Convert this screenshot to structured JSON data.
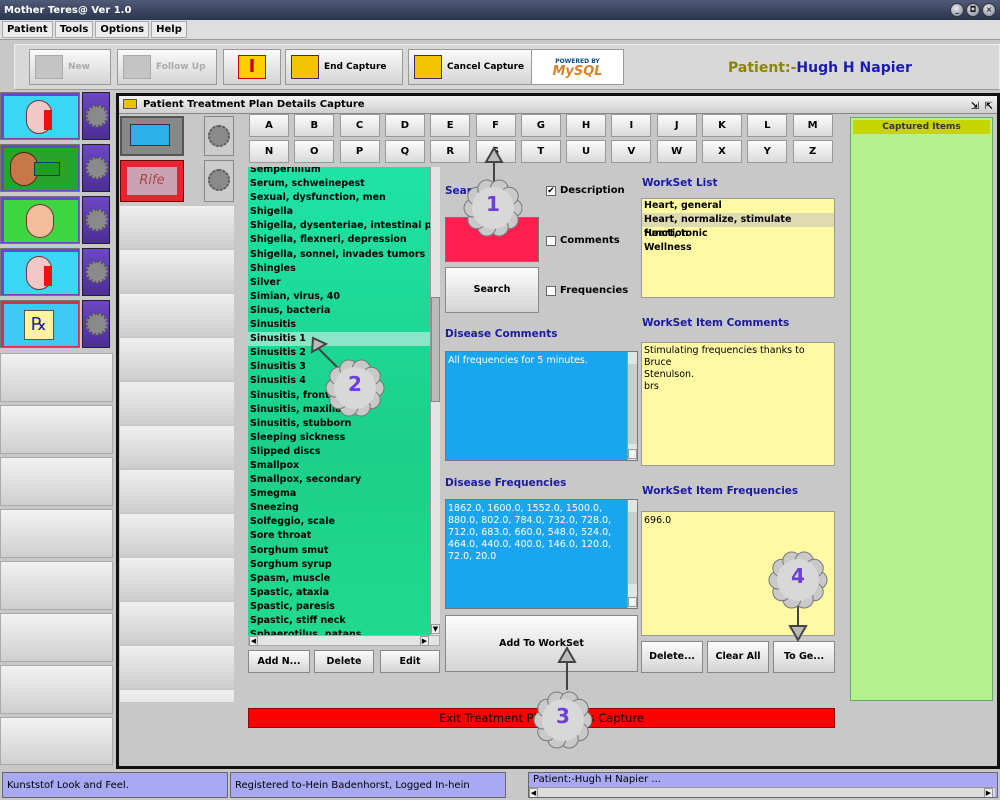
{
  "window": {
    "title": "Mother Teres@ Ver 1.0",
    "controls": [
      "_",
      "◘",
      "×"
    ]
  },
  "menu": [
    "Patient",
    "Tools",
    "Options",
    "Help"
  ],
  "toolbar": {
    "new": "New",
    "follow_up": "Follow Up",
    "end_capture": "End Capture",
    "cancel_capture": "Cancel Capture",
    "mysql_top": "POWERED BY",
    "mysql": "MySQL",
    "patient_prefix": "Patient:-",
    "patient_name": "Hugh H Napier"
  },
  "inner_window": {
    "title": "Patient Treatment Plan Details Capture"
  },
  "letters_row1": [
    "A",
    "B",
    "C",
    "D",
    "E",
    "F",
    "G",
    "H",
    "I",
    "J",
    "K",
    "L",
    "M"
  ],
  "letters_row2": [
    "N",
    "O",
    "P",
    "Q",
    "R",
    "S",
    "T",
    "U",
    "V",
    "W",
    "X",
    "Y",
    "Z"
  ],
  "diseases": [
    "Semperillium",
    "Serum, schweinepest",
    "Sexual, dysfunction, men",
    "Shigella",
    "Shigella, dysenteriae, intestinal problems",
    "Shigella, flexneri, depression",
    "Shigella, sonnel, invades tumors",
    "Shingles",
    "Silver",
    "Simian, virus, 40",
    "Sinus, bacteria",
    "Sinusitis",
    "Sinusitis 1",
    "Sinusitis 2",
    "Sinusitis 3",
    "Sinusitis 4",
    "Sinusitis, frontalis",
    "Sinusitis, maxillaris",
    "Sinusitis, stubborn",
    "Sleeping sickness",
    "Slipped discs",
    "Smallpox",
    "Smallpox, secondary",
    "Smegma",
    "Sneezing",
    "Solfeggio, scale",
    "Sore throat",
    "Sorghum smut",
    "Sorghum syrup",
    "Spasm, muscle",
    "Spastic, ataxia",
    "Spastic, paresis",
    "Spastic, stiff neck",
    "Sphaerotilus, natans"
  ],
  "selected_index": 12,
  "list_buttons": {
    "add": "Add N...",
    "delete": "Delete",
    "edit": "Edit"
  },
  "search": {
    "label": "Search",
    "button": "Search",
    "opt_description": "Description",
    "opt_comments": "Comments",
    "opt_frequencies": "Frequencies",
    "description_checked": true,
    "comments_checked": false,
    "frequencies_checked": false
  },
  "disease_comments": {
    "header": "Disease Comments",
    "text": "All frequencies for 5 minutes."
  },
  "disease_frequencies": {
    "header": "Disease Frequencies",
    "text": "1862.0, 1600.0, 1552.0, 1500.0, 880.0, 802.0, 784.0, 732.0, 728.0, 712.0, 683.0, 660.0, 548.0, 524.0, 464.0, 440.0, 400.0, 146.0, 120.0, 72.0, 20.0"
  },
  "add_to_workset": "Add To WorkSet",
  "workset": {
    "header": "WorkSet List",
    "items": [
      "Heart, general",
      "Heart, normalize, stimulate function",
      "Heart, tonic",
      "Wellness"
    ],
    "selected_index": 1
  },
  "workset_comments": {
    "header": "WorkSet Item Comments",
    "line1": "Stimulating frequencies thanks to Bruce",
    "line2": "Stenulson.",
    "line3": "brs"
  },
  "workset_frequencies": {
    "header": "WorkSet Item Frequencies",
    "text": "696.0"
  },
  "workset_buttons": {
    "delete": "Delete...",
    "clear": "Clear All",
    "to_ge": "To Ge..."
  },
  "captured": {
    "header": "Captured Items"
  },
  "exit": {
    "label": "Exit Treatment Plan Details Capture"
  },
  "callouts": [
    "1",
    "2",
    "3",
    "4"
  ],
  "status": {
    "left": "Kunststof Look and Feel.",
    "middle": "Registered to-Hein Badenhorst, Logged In-hein",
    "right": "Patient:-Hugh H Napier ..."
  },
  "colors": {
    "list_bg": "#1fe3a6",
    "blue_box": "#1aa6ef",
    "yellow_box": "#fff9a3",
    "exit_bar": "#ff0000",
    "captured_bg": "#b4f28e",
    "header_blue": "#1a1aa0",
    "patient_name": "#1a1ab4"
  }
}
